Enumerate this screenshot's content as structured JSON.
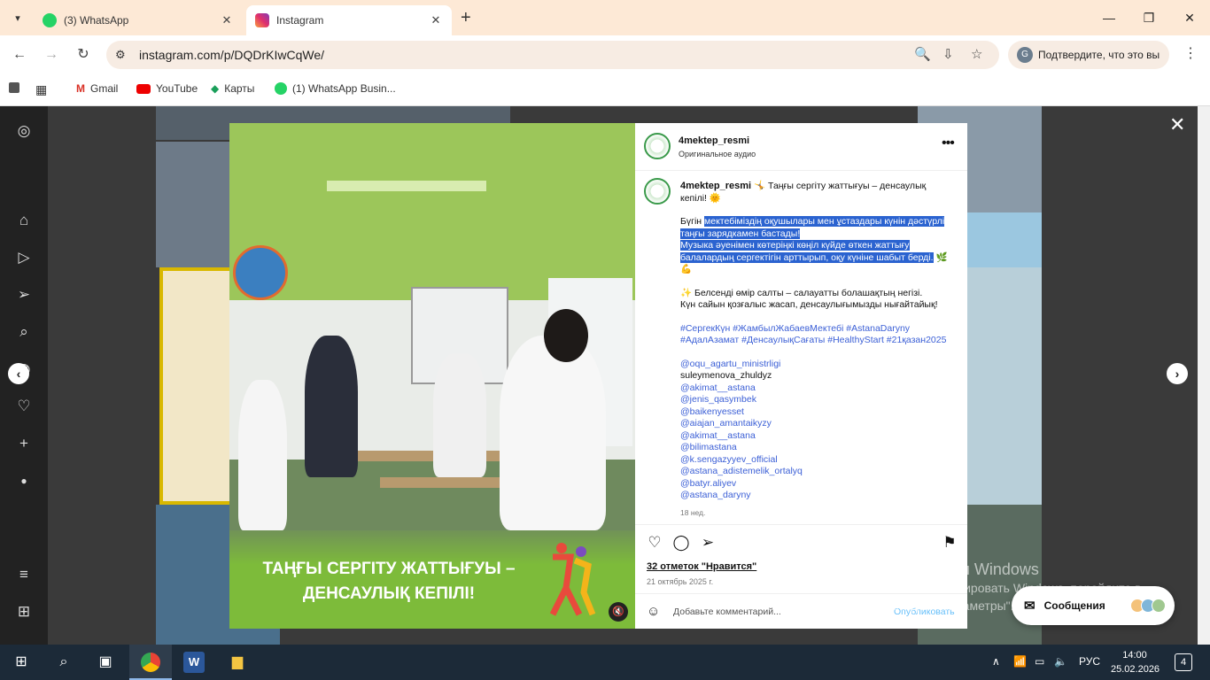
{
  "browser": {
    "tabs": [
      {
        "title": "(3) WhatsApp",
        "active": false,
        "icon": "whatsapp-icon"
      },
      {
        "title": "Instagram",
        "active": true,
        "icon": "instagram-icon"
      }
    ],
    "url": "instagram.com/p/DQDrKIwCqWe/",
    "confirm_label": "Подтвердите, что это вы",
    "bookmarks": [
      {
        "label": "Gmail",
        "icon": "gmail-icon"
      },
      {
        "label": "YouTube",
        "icon": "youtube-icon"
      },
      {
        "label": "Карты",
        "icon": "maps-icon"
      },
      {
        "label": "(1) WhatsApp Busin...",
        "icon": "whatsapp-icon"
      }
    ]
  },
  "post": {
    "username": "4mektep_resmi",
    "audio": "Оригинальное аудио",
    "video_title": "ТАҢҒЫ СЕРГІТУ ЖАТТЫҒУЫ – ДЕНСАУЛЫҚ КЕПІЛІ!",
    "caption_head": "🤸 Таңғы сергіту жаттығуы – денсаулық кепілі! 🌞",
    "caption_plain_start": "Бүгін ",
    "caption_highlight_1": "мектебіміздің оқушылары мен ұстаздары күнін дәстүрлі таңғы зарядкамен бастады!",
    "caption_highlight_2": "Музыка әуенімен көтеріңкі көңіл күйде өткен жаттығу балалардың сергектігін арттырып, оқу күніне шабыт берді.",
    "caption_line_end": " 🌿💪",
    "caption_line3": "✨ Белсенді өмір салты – салауатты болашақтың негізі.",
    "caption_line4": "Күн сайын қозғалыс жасап, денсаулығымызды нығайтайық!",
    "hashtags": "#СергекКүн #ЖамбылЖабаевМектебі #AstanaDaryny #АдалАзамат #ДенсаулықСағаты #HealthyStart #21қазан2025",
    "mentions": [
      {
        "text": "@oqu_agartu_ministrligi",
        "link": true
      },
      {
        "text": "suleymenova_zhuldyz",
        "link": false
      },
      {
        "text": "@akimat__astana",
        "link": true
      },
      {
        "text": "@jenis_qasymbek",
        "link": true
      },
      {
        "text": "@baikenyesset",
        "link": true
      },
      {
        "text": "@aiajan_amantaikyzy",
        "link": true
      },
      {
        "text": "@akimat__astana",
        "link": true
      },
      {
        "text": "@bilimastana",
        "link": true
      },
      {
        "text": "@k.sengazyyev_official",
        "link": true
      },
      {
        "text": "@astana_adistemelik_ortalyq",
        "link": true
      },
      {
        "text": "@batyr.aliyev",
        "link": true
      },
      {
        "text": "@astana_daryny",
        "link": true
      }
    ],
    "age": "18 нед.",
    "likes": "32 отметок \"Нравится\"",
    "date": "21 октябрь 2025 г.",
    "comment_placeholder": "Добавьте комментарий...",
    "publish": "Опубликовать"
  },
  "watermark": {
    "title": "Активация Windows",
    "text": "Чтобы активировать Windows, перейдите в раздел \"Параметры\"."
  },
  "messages_label": "Сообщения",
  "taskbar": {
    "lang": "РУС",
    "time": "14:00",
    "date": "25.02.2026",
    "notifications": "4"
  }
}
